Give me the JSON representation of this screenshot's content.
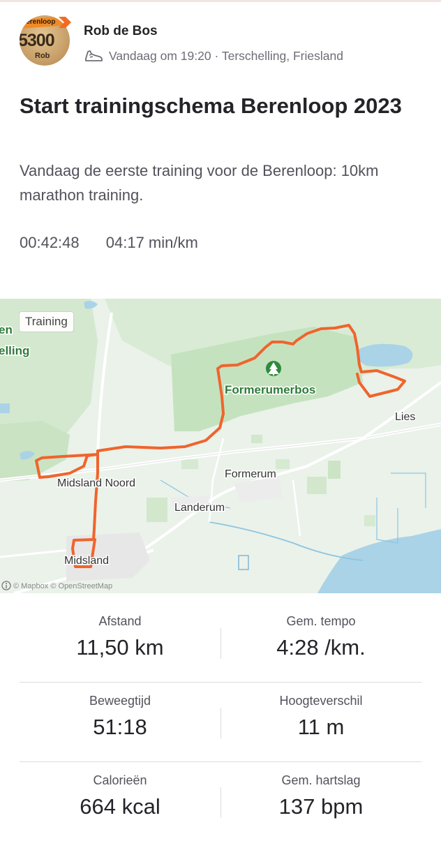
{
  "activity": {
    "athlete_name": "Rob de Bos",
    "timestamp_location": "Vandaag om 19:20 · Terschelling, Friesland",
    "title": "Start trainingschema Berenloop 2023",
    "description": "Vandaag de eerste training voor de Berenloop: 10km marathon training.",
    "elapsed_time": "00:42:48",
    "pace_summary": "04:17 min/km"
  },
  "avatar": {
    "brand_text": "Berenloop",
    "bib_number": "5300",
    "bib_name": "Rob"
  },
  "map": {
    "badge": "Training",
    "attribution": "© Mapbox © OpenStreetMap",
    "route_color": "#f0642c",
    "labels": {
      "formerumerbos": "Formerumerbos",
      "lies": "Lies",
      "formerum": "Formerum",
      "midsland_noord": "Midsland Noord",
      "landerum": "Landerum",
      "midsland": "Midsland",
      "partial_1": "en",
      "partial_2": "elling"
    }
  },
  "stats": [
    {
      "left_label": "Afstand",
      "left_value": "11,50 km",
      "right_label": "Gem. tempo",
      "right_value": "4:28 /km."
    },
    {
      "left_label": "Beweegtijd",
      "left_value": "51:18",
      "right_label": "Hoogteverschil",
      "right_value": "11 m"
    },
    {
      "left_label": "Calorieën",
      "left_value": "664 kcal",
      "right_label": "Gem. hartslag",
      "right_value": "137 bpm"
    }
  ],
  "icons": {
    "shoe": "running-shoe-icon",
    "tree": "tree-icon",
    "info": "info-icon"
  }
}
